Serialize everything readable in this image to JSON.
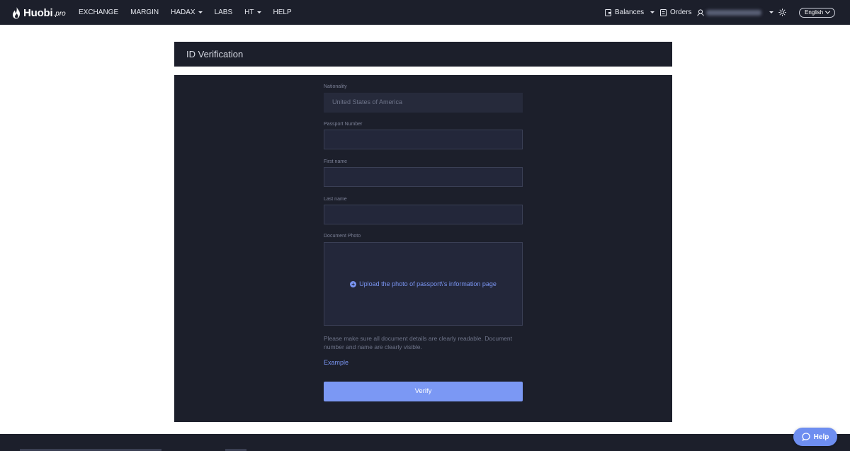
{
  "brand": {
    "name": "Huobi",
    "tld": ".pro"
  },
  "nav": {
    "exchange": "EXCHANGE",
    "margin": "MARGIN",
    "hadax": "HADAX",
    "labs": "LABS",
    "ht": "HT",
    "help": "HELP"
  },
  "account_nav": {
    "balances": "Balances",
    "orders": "Orders",
    "language": "English"
  },
  "page": {
    "title": "ID Verification"
  },
  "form": {
    "nationality_label": "Nationality",
    "nationality_value": "United States of America",
    "passport_label": "Passport Number",
    "passport_value": "",
    "first_name_label": "First name",
    "first_name_value": "",
    "last_name_label": "Last name",
    "last_name_value": "",
    "document_label": "Document Photo",
    "upload_text": "Upload the photo of passport\\'s information page",
    "hint": "Please make sure all document details are clearly readable. Document number and name are clearly visible.",
    "example_link": "Example",
    "verify_button": "Verify"
  },
  "help_button": "Help",
  "colors": {
    "nav_bg": "#1c1f2b",
    "accent": "#7b98f4",
    "link": "#7a95f2"
  }
}
